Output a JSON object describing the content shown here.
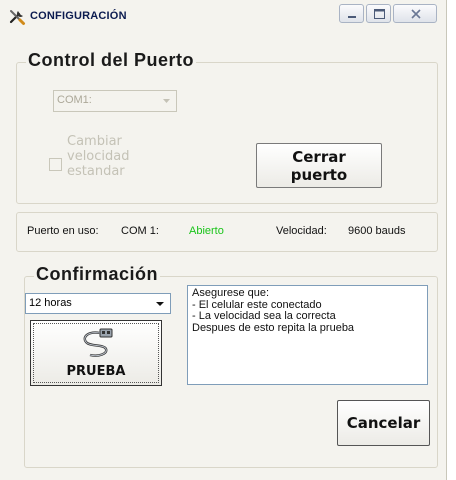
{
  "window": {
    "title": "CONFIGURACIÓN",
    "icon": "tools-icon",
    "controls": [
      "minimize-icon",
      "maximize-icon",
      "close-icon"
    ]
  },
  "port_group": {
    "title": "Control del  Puerto",
    "port_select": {
      "value": "COM1:",
      "disabled": true
    },
    "change_speed_checkbox": {
      "label_lines": [
        "Cambiar",
        "velocidad",
        "estandar"
      ],
      "checked": false,
      "disabled": true
    },
    "close_button_lines": [
      "Cerrar",
      "puerto"
    ]
  },
  "status_bar": {
    "port_label": "Puerto en uso:",
    "port_value": "COM 1:",
    "state": "Abierto",
    "speed_label": "Velocidad:",
    "speed_value": "9600 bauds"
  },
  "confirm_group": {
    "title": "Confirmación",
    "interval_select": {
      "value": "12 horas"
    },
    "test_button_label": "PRUEBA",
    "test_button_icon": "usb-cable-icon",
    "message_lines": [
      "Asegurese que:",
      "- El celular este conectado",
      "- La velocidad sea la correcta",
      "Despues de esto repita la prueba"
    ]
  },
  "cancel_button_label": "Cancelar",
  "colors": {
    "window_bg": "#f4f3ee",
    "title_text": "#0b1b4f",
    "open_status": "#19c419",
    "disabled_text": "#c4c2b6"
  }
}
